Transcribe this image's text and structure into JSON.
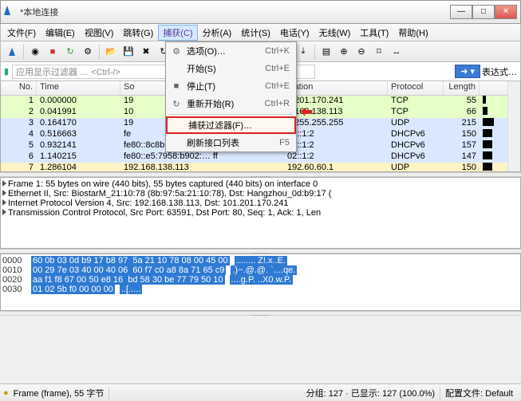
{
  "window": {
    "title": "*本地连接"
  },
  "menu": {
    "items": [
      {
        "label": "文件(F)"
      },
      {
        "label": "编辑(E)"
      },
      {
        "label": "视图(V)"
      },
      {
        "label": "跳转(G)"
      },
      {
        "label": "捕获(C)",
        "open": true
      },
      {
        "label": "分析(A)"
      },
      {
        "label": "统计(S)"
      },
      {
        "label": "电话(Y)"
      },
      {
        "label": "无线(W)"
      },
      {
        "label": "工具(T)"
      },
      {
        "label": "帮助(H)"
      }
    ]
  },
  "dropdown": [
    {
      "icon": "⚙",
      "label": "选项(O)…",
      "accel": "Ctrl+K"
    },
    {
      "icon": "",
      "label": "开始(S)",
      "accel": "Ctrl+E"
    },
    {
      "icon": "■",
      "label": "停止(T)",
      "accel": "Ctrl+E"
    },
    {
      "icon": "↻",
      "label": "重新开始(R)",
      "accel": "Ctrl+R"
    },
    {
      "sep": true
    },
    {
      "icon": "",
      "label": "捕获过滤器(F)…",
      "accel": "",
      "hl": true
    },
    {
      "icon": "",
      "label": "刷新接口列表",
      "accel": "F5"
    }
  ],
  "filter": {
    "placeholder": "应用显示过滤器 … <Ctrl-/>",
    "expr": "表达式…"
  },
  "packet_headers": [
    "No.",
    "Time",
    "So",
    "ination",
    "Protocol",
    "Length"
  ],
  "packets": [
    {
      "no": "1",
      "time": "0.000000",
      "src": "19",
      "dst": "1.201.170.241",
      "proto": "TCP",
      "len": "55",
      "cls": "bg-g",
      "bw": 4
    },
    {
      "no": "2",
      "time": "0.041991",
      "src": "10",
      "dst": "2.168.138.113",
      "proto": "TCP",
      "len": "66",
      "cls": "bg-g",
      "bw": 6
    },
    {
      "no": "3",
      "time": "0.164170",
      "src": "19",
      "dst": "5.255.255.255",
      "proto": "UDP",
      "len": "215",
      "cls": "bg-b",
      "bw": 14
    },
    {
      "no": "4",
      "time": "0.516663",
      "src": "fe",
      "dst": "02::1:2",
      "proto": "DHCPv6",
      "len": "150",
      "cls": "bg-b",
      "bw": 12
    },
    {
      "no": "5",
      "time": "0.932141",
      "src": "fe80::8c8b:1682:536… ff",
      "dst": "02::1:2",
      "proto": "DHCPv6",
      "len": "157",
      "cls": "bg-b",
      "bw": 12
    },
    {
      "no": "6",
      "time": "1.140215",
      "src": "fe80::e5:7958:b902:… ff",
      "dst": "02::1:2",
      "proto": "DHCPv6",
      "len": "147",
      "cls": "bg-b",
      "bw": 12
    },
    {
      "no": "7",
      "time": "1.286104",
      "src": "192.168.138.113",
      "dst": "192.60.60.1",
      "proto": "UDP",
      "len": "150",
      "cls": "bg-y",
      "bw": 12
    }
  ],
  "details": [
    "Frame 1: 55 bytes on wire (440 bits), 55 bytes captured (440 bits) on interface 0",
    "Ethernet II, Src: BiostarM_21:10:78 (8b:97:5a:21:10:78), Dst: Hangzhou_0d:b9:17 (",
    "Internet Protocol Version 4, Src: 192.168.138.113, Dst: 101.201.170.241",
    "Transmission Control Protocol, Src Port: 63591, Dst Port: 80, Seq: 1, Ack: 1, Len"
  ],
  "hex": {
    "offsets": [
      "0000",
      "0010",
      "0020",
      "0030"
    ],
    "bytes": [
      "60 0b 03 0d b9 17 b8 97  5a 21 10 78 08 00 45 00",
      "00 29 7e 03 40 00 40 06  60 f7 c0 a8 8a 71 65 c9",
      "aa f1 f8 67 00 50 e8 16  bd 58 30 be 77 79 50 10",
      "01 02 5b f0 00 00 00"
    ],
    "ascii": [
      "........ Z!.x..E.",
      ".)~.@.@. `....qe.",
      "....g.P. ..X0.w.P.",
      "..[....."
    ]
  },
  "status": {
    "frame": "Frame (frame), 55 字节",
    "pkts": "分组: 127 · 已显示: 127 (100.0%)",
    "profile": "配置文件: Default"
  }
}
